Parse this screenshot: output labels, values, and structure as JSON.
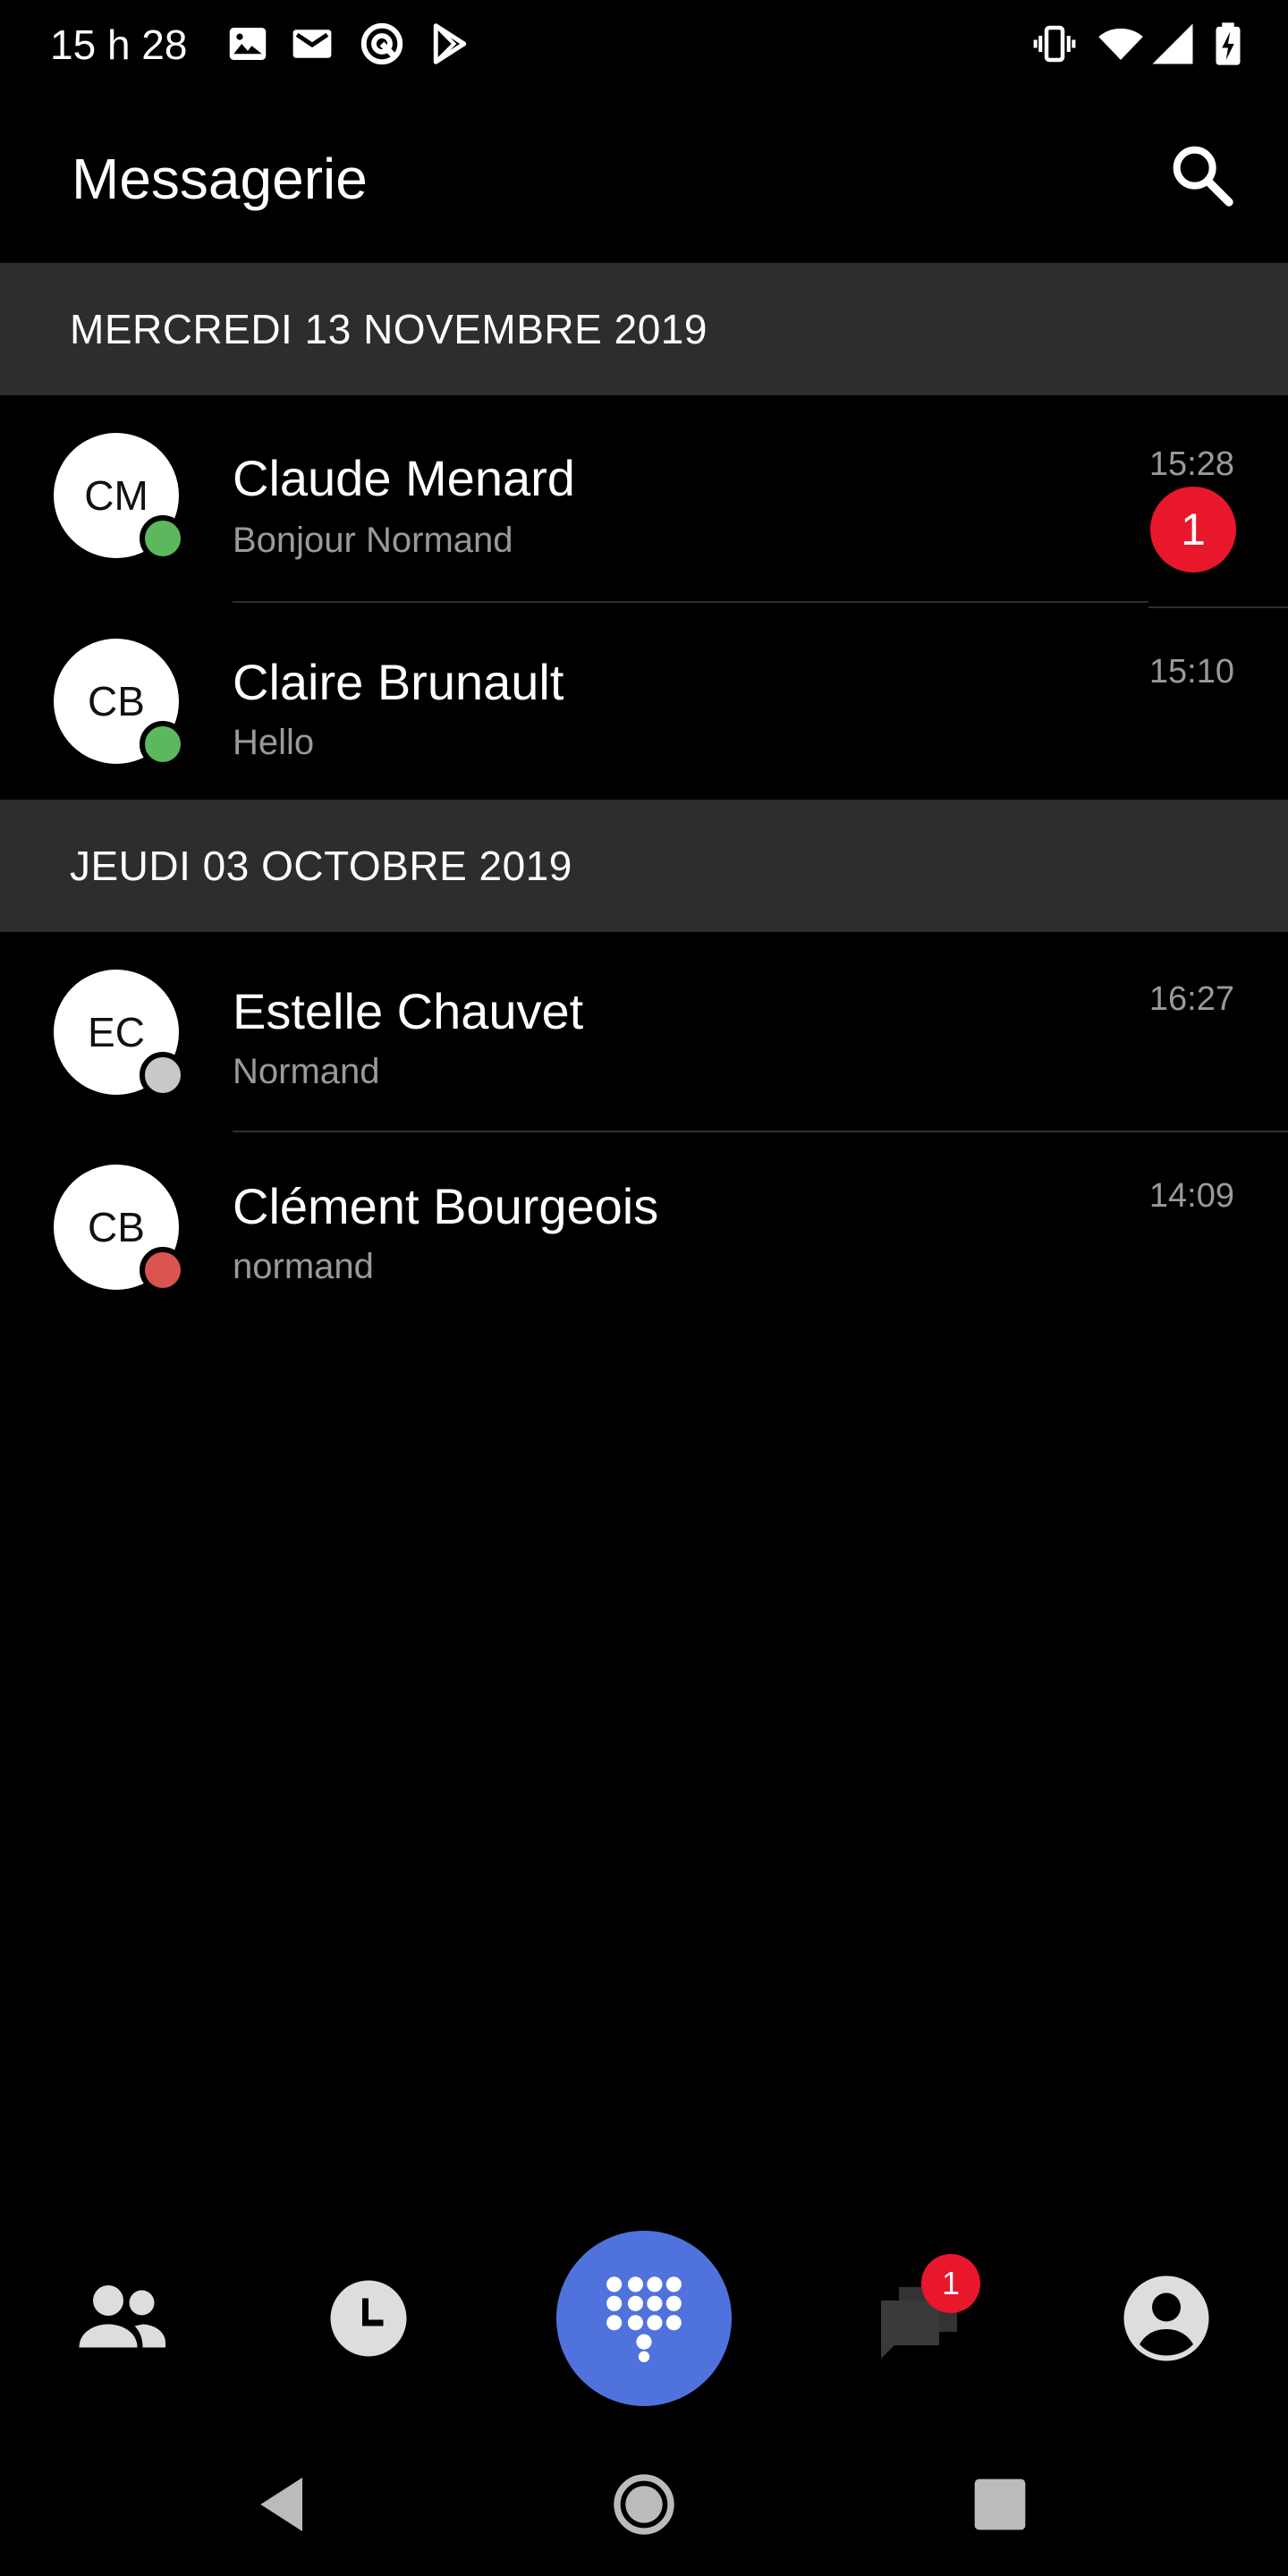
{
  "status_bar": {
    "time": "15 h 28",
    "icons": [
      "image-icon",
      "gmail-icon",
      "sync-icon",
      "play-store-icon",
      "vibrate-icon",
      "wifi-icon",
      "signal-icon",
      "battery-charging-icon"
    ]
  },
  "app_bar": {
    "title": "Messagerie",
    "search_icon": "search-icon"
  },
  "sections": [
    {
      "date": "MERCREDI 13 NOVEMBRE 2019",
      "conversations": [
        {
          "initials": "CM",
          "name": "Claude Menard",
          "preview": "Bonjour Normand",
          "time": "15:28",
          "presence_color": "#5cb85c",
          "unread": "1"
        },
        {
          "initials": "CB",
          "name": "Claire Brunault",
          "preview": "Hello",
          "time": "15:10",
          "presence_color": "#5cb85c"
        }
      ]
    },
    {
      "date": "JEUDI 03 OCTOBRE 2019",
      "conversations": [
        {
          "initials": "EC",
          "name": "Estelle Chauvet",
          "preview": "Normand",
          "time": "16:27",
          "presence_color": "#c8c8c8"
        },
        {
          "initials": "CB",
          "name": "Clément Bourgeois",
          "preview": "normand",
          "time": "14:09",
          "presence_color": "#d9534f"
        }
      ]
    }
  ],
  "bottom_nav": {
    "items": [
      "contacts-icon",
      "history-icon",
      "dialpad-icon",
      "messages-icon",
      "account-icon"
    ],
    "messages_badge": "1",
    "accent_color": "#5072dc"
  },
  "system_nav": [
    "back-icon",
    "home-icon",
    "recents-icon"
  ]
}
